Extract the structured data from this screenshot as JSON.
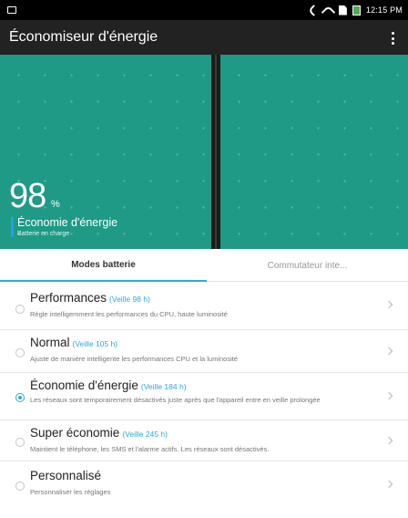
{
  "status_bar": {
    "time": "12:15 PM",
    "icons": [
      "notification-icon",
      "phone-icon",
      "wifi-icon",
      "sim-icon",
      "battery-icon"
    ]
  },
  "app_bar": {
    "title": "Économiseur d'énergie",
    "menu_icon": "overflow-menu-icon"
  },
  "battery_panel": {
    "percent": "98",
    "percent_unit": "%",
    "mode": "Économie d'énergie",
    "status": "Batterie en charge",
    "accent": "#1fa3e0",
    "background": "#1e9a86"
  },
  "tabs": [
    {
      "label": "Modes batterie",
      "selected": true
    },
    {
      "label": "Commutateur inte...",
      "selected": false
    }
  ],
  "modes": [
    {
      "title": "Performances",
      "standby": "(Veille 98  h)",
      "desc": "Règle intelligemment les performances du CPU, haute luminosité",
      "selected": false
    },
    {
      "title": "Normal",
      "standby": "(Veille 105  h)",
      "desc": "Ajuste de manière intelligente les performances CPU et la luminosité",
      "selected": false
    },
    {
      "title": "Économie d'énergie",
      "standby": "(Veille 184  h)",
      "desc": "Les réseaux sont temporairement désactivés juste après que l'appareil entre en veille prolongée",
      "selected": true
    },
    {
      "title": "Super économie",
      "standby": "(Veille 245  h)",
      "desc": "Maintient le téléphone, les SMS et l'alarme actifs. Les réseaux sont désactivés.",
      "selected": false
    },
    {
      "title": "Personnalisé",
      "standby": "",
      "desc": "Personnaliser les réglages",
      "selected": false
    }
  ],
  "colors": {
    "accent_blue": "#2aa9dc",
    "app_bar": "#222222",
    "panel_green": "#1e9a86"
  }
}
